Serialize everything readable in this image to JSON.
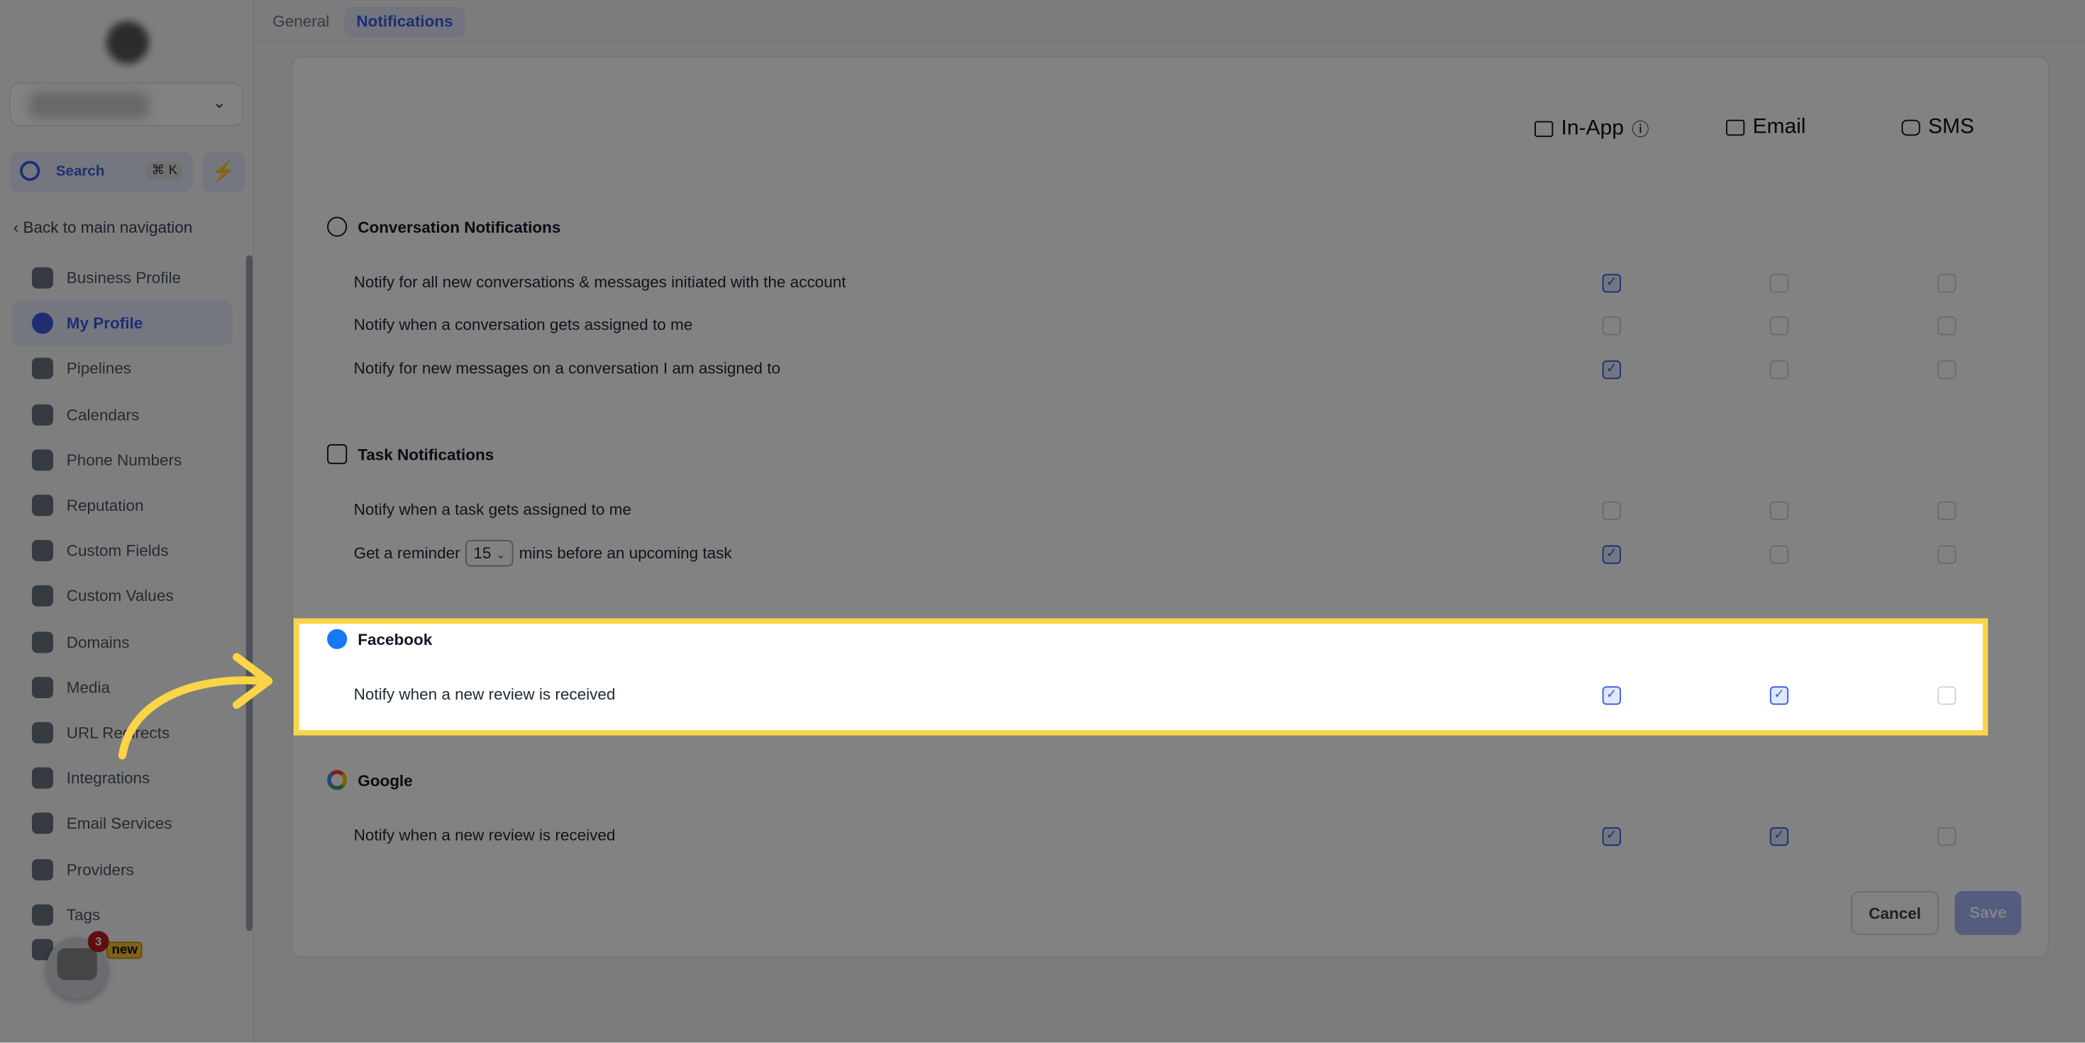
{
  "sidebar": {
    "search_label": "Search",
    "search_shortcut": "⌘ K",
    "back_label": "Back to main navigation",
    "items": [
      {
        "label": "Business Profile",
        "icon": "briefcase-icon"
      },
      {
        "label": "My Profile",
        "icon": "user-icon",
        "active": true
      },
      {
        "label": "Pipelines",
        "icon": "pipeline-icon"
      },
      {
        "label": "Calendars",
        "icon": "calendar-icon"
      },
      {
        "label": "Phone Numbers",
        "icon": "phone-icon"
      },
      {
        "label": "Reputation",
        "icon": "star-icon"
      },
      {
        "label": "Custom Fields",
        "icon": "fields-icon"
      },
      {
        "label": "Custom Values",
        "icon": "values-icon"
      },
      {
        "label": "Domains",
        "icon": "globe-icon"
      },
      {
        "label": "Media",
        "icon": "media-icon"
      },
      {
        "label": "URL Redirects",
        "icon": "link-icon"
      },
      {
        "label": "Integrations",
        "icon": "integrations-icon"
      },
      {
        "label": "Email Services",
        "icon": "mail-icon"
      },
      {
        "label": "Providers",
        "icon": "providers-icon"
      },
      {
        "label": "Tags",
        "icon": "tag-icon"
      }
    ],
    "new_badge": "new",
    "chat_count": "3"
  },
  "tabs": [
    {
      "label": "General"
    },
    {
      "label": "Notifications",
      "active": true
    }
  ],
  "columns": [
    "In-App",
    "Email",
    "SMS"
  ],
  "sections": [
    {
      "title": "Conversation Notifications",
      "icon": "chat-bubble-icon",
      "rows": [
        {
          "label": "Notify for all new conversations & messages initiated with the account",
          "checks": [
            true,
            false,
            false
          ]
        },
        {
          "label": "Notify when a conversation gets assigned to me",
          "checks": [
            false,
            false,
            false
          ]
        },
        {
          "label": "Notify for new messages on a conversation I am assigned to",
          "checks": [
            true,
            false,
            false
          ]
        }
      ]
    },
    {
      "title": "Task Notifications",
      "icon": "task-icon",
      "rows": [
        {
          "label": "Notify when a task gets assigned to me",
          "checks": [
            false,
            false,
            false
          ]
        },
        {
          "label_pre": "Get a reminder",
          "select_value": "15",
          "label_post": "mins before an upcoming task",
          "checks": [
            true,
            false,
            false
          ]
        }
      ]
    },
    {
      "title": "Facebook",
      "icon": "facebook-icon",
      "rows": [
        {
          "label": "Notify when a new review is received",
          "checks": [
            true,
            true,
            false
          ]
        }
      ]
    },
    {
      "title": "Google",
      "icon": "google-icon",
      "rows": [
        {
          "label": "Notify when a new review is received",
          "checks": [
            true,
            true,
            false
          ]
        }
      ]
    }
  ],
  "actions": {
    "cancel": "Cancel",
    "save": "Save"
  },
  "colors": {
    "accent": "#3b5bdb",
    "highlight": "#f9d547"
  }
}
